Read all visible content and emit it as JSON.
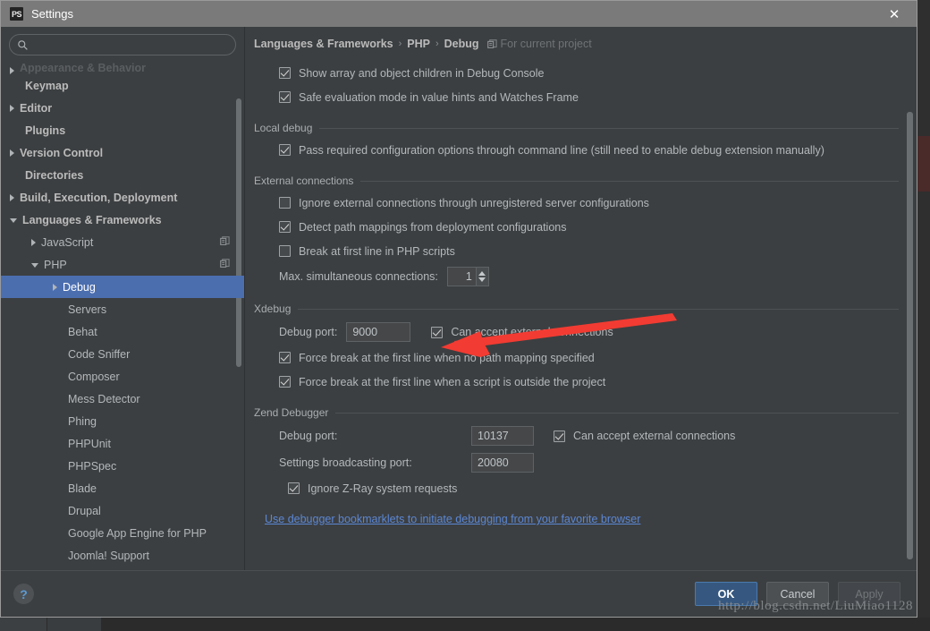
{
  "window": {
    "app_icon": "PS",
    "title": "Settings",
    "close_icon": "close-icon"
  },
  "search": {
    "value": "",
    "placeholder": "",
    "icon": "search-icon"
  },
  "sidebar": {
    "items": [
      {
        "label": "Appearance & Behavior",
        "indent": 0,
        "arrow": "right",
        "bold": true,
        "clipped": true
      },
      {
        "label": "Keymap",
        "indent": 0,
        "arrow": "none",
        "bold": true
      },
      {
        "label": "Editor",
        "indent": 0,
        "arrow": "right",
        "bold": true
      },
      {
        "label": "Plugins",
        "indent": 0,
        "arrow": "none",
        "bold": true
      },
      {
        "label": "Version Control",
        "indent": 0,
        "arrow": "right",
        "bold": true
      },
      {
        "label": "Directories",
        "indent": 0,
        "arrow": "none",
        "bold": true
      },
      {
        "label": "Build, Execution, Deployment",
        "indent": 0,
        "arrow": "right",
        "bold": true
      },
      {
        "label": "Languages & Frameworks",
        "indent": 0,
        "arrow": "down",
        "bold": true
      },
      {
        "label": "JavaScript",
        "indent": 1,
        "arrow": "right",
        "bold": false,
        "badge": "copy-icon"
      },
      {
        "label": "PHP",
        "indent": 1,
        "arrow": "down",
        "bold": false,
        "badge": "copy-icon"
      },
      {
        "label": "Debug",
        "indent": 2,
        "arrow": "right",
        "bold": false,
        "selected": true
      },
      {
        "label": "Servers",
        "indent": 2,
        "arrow": "none",
        "bold": false
      },
      {
        "label": "Behat",
        "indent": 2,
        "arrow": "none",
        "bold": false
      },
      {
        "label": "Code Sniffer",
        "indent": 2,
        "arrow": "none",
        "bold": false
      },
      {
        "label": "Composer",
        "indent": 2,
        "arrow": "none",
        "bold": false
      },
      {
        "label": "Mess Detector",
        "indent": 2,
        "arrow": "none",
        "bold": false
      },
      {
        "label": "Phing",
        "indent": 2,
        "arrow": "none",
        "bold": false
      },
      {
        "label": "PHPUnit",
        "indent": 2,
        "arrow": "none",
        "bold": false
      },
      {
        "label": "PHPSpec",
        "indent": 2,
        "arrow": "none",
        "bold": false
      },
      {
        "label": "Blade",
        "indent": 2,
        "arrow": "none",
        "bold": false
      },
      {
        "label": "Drupal",
        "indent": 2,
        "arrow": "none",
        "bold": false
      },
      {
        "label": "Google App Engine for PHP",
        "indent": 2,
        "arrow": "none",
        "bold": false
      },
      {
        "label": "Joomla! Support",
        "indent": 2,
        "arrow": "none",
        "bold": false
      }
    ]
  },
  "breadcrumb": {
    "part1": "Languages & Frameworks",
    "sep1": "›",
    "part2": "PHP",
    "sep2": "›",
    "part3": "Debug",
    "scope_icon": "copy-icon",
    "scope_label": "For current project"
  },
  "main": {
    "top_options": [
      {
        "label": "Show array and object children in Debug Console",
        "checked": true
      },
      {
        "label": "Safe evaluation mode in value hints and Watches Frame",
        "checked": true
      }
    ],
    "local_debug": {
      "title": "Local debug",
      "options": [
        {
          "label": "Pass required configuration options through command line (still need to enable debug extension manually)",
          "checked": true
        }
      ]
    },
    "external_connections": {
      "title": "External connections",
      "options": [
        {
          "label": "Ignore external connections through unregistered server configurations",
          "checked": false
        },
        {
          "label": "Detect path mappings from deployment configurations",
          "checked": true
        },
        {
          "label": "Break at first line in PHP scripts",
          "checked": false
        }
      ],
      "max_connections_label": "Max. simultaneous connections:",
      "max_connections_value": "1"
    },
    "xdebug": {
      "title": "Xdebug",
      "debug_port_label": "Debug port:",
      "debug_port_value": "9000",
      "accept_external_label": "Can accept external connections",
      "accept_external_checked": true,
      "options": [
        {
          "label": "Force break at the first line when no path mapping specified",
          "checked": true
        },
        {
          "label": "Force break at the first line when a script is outside the project",
          "checked": true
        }
      ]
    },
    "zend_debugger": {
      "title": "Zend Debugger",
      "debug_port_label": "Debug port:",
      "debug_port_value": "10137",
      "accept_external_label": "Can accept external connections",
      "accept_external_checked": true,
      "broadcast_label": "Settings broadcasting port:",
      "broadcast_value": "20080",
      "zray_label": "Ignore Z-Ray system requests",
      "zray_checked": true
    },
    "bookmarklets_link": "Use debugger bookmarklets to initiate debugging from your favorite browser"
  },
  "footer": {
    "help_icon": "?",
    "ok_label": "OK",
    "cancel_label": "Cancel",
    "apply_label": "Apply"
  },
  "annotation": {
    "arrow_color": "#f23b32",
    "target": "xdebug-can-accept-external-connections-checkbox"
  },
  "watermark": {
    "text": "http://blog.csdn.net/LiuMiao1128"
  },
  "colors": {
    "dialog_bg": "#3c3f41",
    "titlebar": "#7a7a7a",
    "selection": "#4b6eaf",
    "link": "#5b87d4",
    "primary_button": "#365880"
  }
}
